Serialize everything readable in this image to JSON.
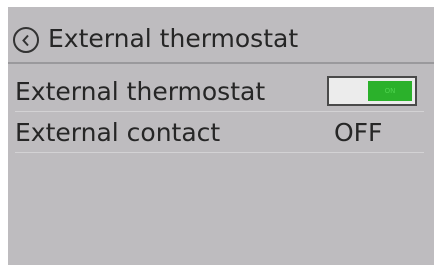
{
  "header": {
    "title": "External thermostat",
    "back_icon": "chevron-left-circle-icon"
  },
  "settings": [
    {
      "label": "External thermostat",
      "control": "toggle",
      "value": "ON",
      "on": true
    },
    {
      "label": "External contact",
      "control": "text",
      "value": "OFF"
    }
  ],
  "colors": {
    "background": "#bebcbf",
    "toggle_on": "#2bb12b",
    "text": "#262626"
  }
}
